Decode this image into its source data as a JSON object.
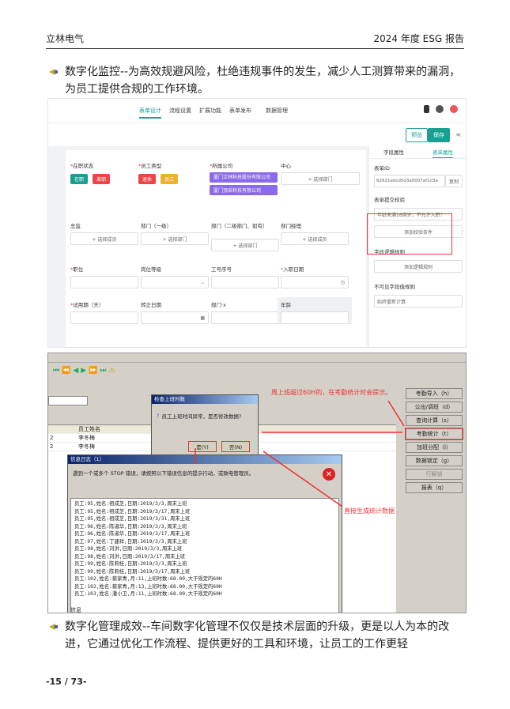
{
  "header": {
    "company": "立林电气",
    "report": "2024 年度 ESG 报告"
  },
  "para1": "数字化监控--为高效规避风险，杜绝违规事件的发生，减少人工测算带来的漏洞，为员工提供合规的工作环境。",
  "para2": "数字化管理成效--车间数字化管理不仅仅是技术层面的升级，更是以人为本的改进，它通过优化工作流程、提供更好的工具和环境，让员工的工作更轻",
  "footer": {
    "page": "-15 / 73-"
  },
  "shot1": {
    "tabs": [
      "表单设计",
      "流程设置",
      "扩展功能",
      "表单发布",
      "数据管理"
    ],
    "btn_preview": "预览",
    "btn_save": "保存",
    "side_tabs": [
      "字段属性",
      "表单属性"
    ],
    "form_id_label": "表单ID",
    "form_id_value": "62621edcd5d3a0007af1d3a",
    "copy": "复制",
    "validation_label": "表单提交校验",
    "validation_msg": "年龄未满16周岁，不允许入职！",
    "add_validation": "添加校验条件",
    "calc_rule_label": "字段逻辑规则",
    "add_rule": "添加逻辑规则",
    "invisible_label": "不可见字段值规则",
    "invisible_value": "始终重新计算",
    "fields": {
      "status": "在职状态",
      "status_opts": [
        "在职",
        "离职"
      ],
      "emp_type": "员工类型",
      "emp_type_opts": [
        "退休",
        "员工"
      ],
      "company": "所属公司",
      "company_a": "厦门立林科技股份有限公司",
      "company_b": "厦门顶采科技有限公司",
      "center": "中心",
      "select_dept": "+ 选择部门",
      "group": "总监",
      "select_member": "+ 选择成员",
      "dept1": "部门（一级）",
      "dept2": "部门（二级部门、如有）",
      "dept_mgr": "部门经理",
      "job": "职位",
      "level": "岗位等级",
      "emp_no": "工号序号",
      "entry_date": "入职日期",
      "probation": "试用期（天）",
      "regular_date": "转正日期",
      "dept_x": "部门·x",
      "age": "年龄"
    }
  },
  "shot2": {
    "dlg_title": "检查上班时数",
    "dlg_msg": "员工上班时间异常，是否修改数据?",
    "yes": "是(Y)",
    "no": "否(N)",
    "log_title": "信息日志（1）",
    "log_msg": "遇到一个或多个 STOP 错误，请按照以下错误信息的提示行动，或致电管理员。",
    "anno_top": "周上班超过60H的，在考勤统计时会提示。",
    "anno_bottom": "直接生成统计数据",
    "col_header": "员工姓名",
    "names": [
      "李冬梅",
      "李冬梅"
    ],
    "buttons": [
      "考勤导入（h）",
      "公出/调班（d）",
      "查询计算（s）",
      "考勤统计（t）",
      "加班分配（l）",
      "数据锁定（g）",
      "行解锁",
      "报表（q）"
    ],
    "logs": [
      "员工:95,姓名:祖成芝,日期:2019/3/3,周末上班",
      "员工:95,姓名:祖成芝,日期:2019/3/17,周末上班",
      "员工:95,姓名:祖成芝,日期:2019/3/31,周末上班",
      "员工:96,姓名:陈淑华,日期:2019/3/3,周末上班",
      "员工:96,姓名:陈淑华,日期:2019/3/17,周末上班",
      "员工:97,姓名:丁建祥,日期:2019/3/3,周末上班",
      "员工:98,姓名:刘洪,日期:2019/3/3,周末上班",
      "员工:98,姓名:刘洪,日期:2019/3/17,周末上班",
      "员工:99,姓名:陈莉桂,日期:2019/3/3,周末上班",
      "员工:99,姓名:陈莉桂,日期:2019/3/17,周末上班",
      "员工:102,姓名:蔡家青,月:11,上班时数:68.00,大于规定的60H",
      "员工:102,姓名:蔡家青,月:13,上班时数:68.00,大于规定的60H",
      "员工:103,姓名:潘小卫,月:11,上班时数:68.00,大于规定的60H"
    ],
    "status": "信息"
  },
  "colors": {
    "accent": "#19a093",
    "red": "#e33333"
  }
}
